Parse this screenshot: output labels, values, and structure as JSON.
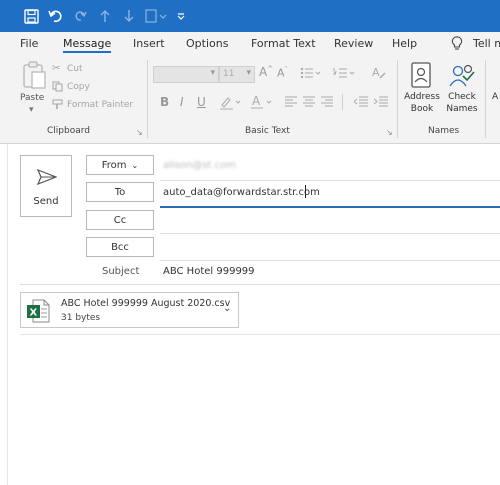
{
  "menu": [
    "File",
    "Message",
    "Insert",
    "Options",
    "Format Text",
    "Review",
    "Help",
    "Tell m"
  ],
  "ribbon": {
    "clipboard": {
      "paste": "Paste",
      "cut": "Cut",
      "copy": "Copy",
      "format_painter": "Format Painter",
      "label": "Clipboard"
    },
    "basic_text": {
      "font_size": "11",
      "label": "Basic Text"
    },
    "names": {
      "address_book": [
        "Address",
        "Book"
      ],
      "check_names": [
        "Check",
        "Names"
      ],
      "label": "Names"
    },
    "partial_next": "A"
  },
  "compose": {
    "send_label": "Send",
    "from_label": "From",
    "from_value": "alison@st.com",
    "to_label": "To",
    "to_value": "auto_data@forwardstar.str.com",
    "cc_label": "Cc",
    "bcc_label": "Bcc",
    "subject_label": "Subject",
    "subject_value": "ABC Hotel 999999",
    "attachment": {
      "name": "ABC Hotel 999999 August 2020.csv",
      "size": "31 bytes",
      "icon_letter": "X"
    }
  },
  "colors": {
    "titlebar": "#1f6fc4",
    "accent": "#1f6fc4",
    "excel": "#1d7044"
  }
}
